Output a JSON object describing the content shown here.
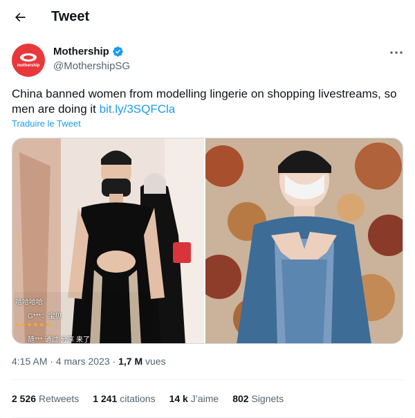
{
  "header": {
    "title": "Tweet",
    "back_icon": "arrow-left-icon"
  },
  "author": {
    "display_name": "Mothership",
    "handle": "@MothershipSG",
    "avatar_text": "mothership",
    "verified": true,
    "brand_color": "#e8383b"
  },
  "tweet": {
    "text": "China banned women from modelling lingerie on shopping livestreams, so men are doing it ",
    "link": "bit.ly/3SQFCla",
    "translate_label": "Traduire le Tweet",
    "overlay_comments": [
      "哈哈哈哈",
      "G***：宝贝",
      "随*** 通过 分享 来了"
    ]
  },
  "meta": {
    "time": "4:15 AM",
    "date": "4 mars 2023",
    "views_count": "1,7 M",
    "views_label": "vues"
  },
  "stats": [
    {
      "count": "2 526",
      "label": "Retweets"
    },
    {
      "count": "1 241",
      "label": "citations"
    },
    {
      "count": "14 k",
      "label": "J’aime"
    },
    {
      "count": "802",
      "label": "Signets"
    }
  ],
  "colors": {
    "accent": "#1d9bf0",
    "text": "#0f1419",
    "muted": "#536471"
  }
}
